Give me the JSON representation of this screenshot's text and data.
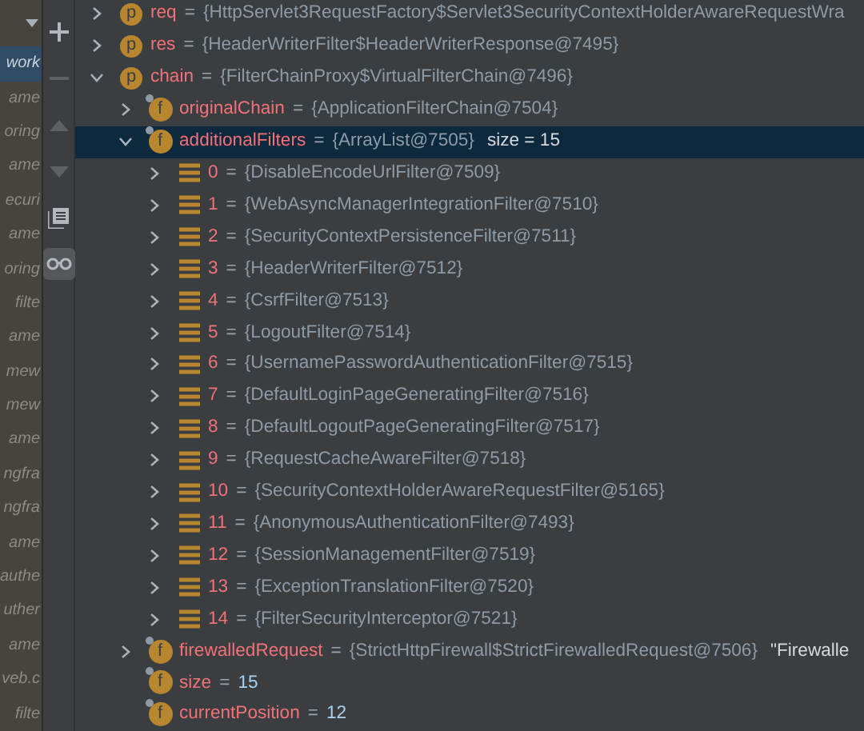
{
  "frames": [
    {
      "text": "work",
      "selected": true
    },
    {
      "text": "ame",
      "selected": false
    },
    {
      "text": "oring",
      "selected": false
    },
    {
      "text": "ame",
      "selected": false
    },
    {
      "text": "ecuri",
      "selected": false
    },
    {
      "text": "ame",
      "selected": false
    },
    {
      "text": "oring",
      "selected": false
    },
    {
      "text": "filte",
      "selected": false
    },
    {
      "text": "ame",
      "selected": false
    },
    {
      "text": "mew",
      "selected": false
    },
    {
      "text": "mew",
      "selected": false
    },
    {
      "text": "ame",
      "selected": false
    },
    {
      "text": "ngfra",
      "selected": false
    },
    {
      "text": "ngfra",
      "selected": false
    },
    {
      "text": "ame",
      "selected": false
    },
    {
      "text": "authe",
      "selected": false
    },
    {
      "text": "uther",
      "selected": false
    },
    {
      "text": "ame",
      "selected": false
    },
    {
      "text": "veb.c",
      "selected": false
    },
    {
      "text": "filte",
      "selected": false
    }
  ],
  "toolbar": [
    {
      "kind": "add",
      "disabled": false,
      "selected": false
    },
    {
      "kind": "remove",
      "disabled": true,
      "selected": false
    },
    {
      "kind": "up",
      "disabled": true,
      "selected": false
    },
    {
      "kind": "down",
      "disabled": true,
      "selected": false
    },
    {
      "kind": "copy",
      "disabled": false,
      "selected": false
    },
    {
      "kind": "watch",
      "disabled": false,
      "selected": true
    }
  ],
  "variables": [
    {
      "kind": "param",
      "icon": "p",
      "name": "req",
      "op": "=",
      "value": "{HttpServlet3RequestFactory$Servlet3SecurityContextHolderAwareRequestWra",
      "primitive": false,
      "expandable": true,
      "expanded": false,
      "selected": false
    },
    {
      "kind": "param",
      "icon": "p",
      "name": "res",
      "op": "=",
      "value": "{HeaderWriterFilter$HeaderWriterResponse@7495}",
      "primitive": false,
      "expandable": true,
      "expanded": false,
      "selected": false
    },
    {
      "kind": "param",
      "icon": "p",
      "name": "chain",
      "op": "=",
      "value": "{FilterChainProxy$VirtualFilterChain@7496}",
      "primitive": false,
      "expandable": true,
      "expanded": true,
      "selected": false,
      "children": [
        {
          "kind": "field",
          "icon": "f",
          "name": "originalChain",
          "op": "=",
          "value": "{ApplicationFilterChain@7504}",
          "primitive": false,
          "expandable": true,
          "expanded": false,
          "selected": false
        },
        {
          "kind": "field",
          "icon": "f",
          "name": "additionalFilters",
          "op": "=",
          "value": "{ArrayList@7505}",
          "primitive": false,
          "suffix": "size = 15",
          "expandable": true,
          "expanded": true,
          "selected": true,
          "children": [
            {
              "kind": "element",
              "name": "0",
              "op": "=",
              "value": "{DisableEncodeUrlFilter@7509}",
              "primitive": false,
              "expandable": true,
              "expanded": false,
              "selected": false
            },
            {
              "kind": "element",
              "name": "1",
              "op": "=",
              "value": "{WebAsyncManagerIntegrationFilter@7510}",
              "primitive": false,
              "expandable": true,
              "expanded": false,
              "selected": false
            },
            {
              "kind": "element",
              "name": "2",
              "op": "=",
              "value": "{SecurityContextPersistenceFilter@7511}",
              "primitive": false,
              "expandable": true,
              "expanded": false,
              "selected": false
            },
            {
              "kind": "element",
              "name": "3",
              "op": "=",
              "value": "{HeaderWriterFilter@7512}",
              "primitive": false,
              "expandable": true,
              "expanded": false,
              "selected": false
            },
            {
              "kind": "element",
              "name": "4",
              "op": "=",
              "value": "{CsrfFilter@7513}",
              "primitive": false,
              "expandable": true,
              "expanded": false,
              "selected": false
            },
            {
              "kind": "element",
              "name": "5",
              "op": "=",
              "value": "{LogoutFilter@7514}",
              "primitive": false,
              "expandable": true,
              "expanded": false,
              "selected": false
            },
            {
              "kind": "element",
              "name": "6",
              "op": "=",
              "value": "{UsernamePasswordAuthenticationFilter@7515}",
              "primitive": false,
              "expandable": true,
              "expanded": false,
              "selected": false
            },
            {
              "kind": "element",
              "name": "7",
              "op": "=",
              "value": "{DefaultLoginPageGeneratingFilter@7516}",
              "primitive": false,
              "expandable": true,
              "expanded": false,
              "selected": false
            },
            {
              "kind": "element",
              "name": "8",
              "op": "=",
              "value": "{DefaultLogoutPageGeneratingFilter@7517}",
              "primitive": false,
              "expandable": true,
              "expanded": false,
              "selected": false
            },
            {
              "kind": "element",
              "name": "9",
              "op": "=",
              "value": "{RequestCacheAwareFilter@7518}",
              "primitive": false,
              "expandable": true,
              "expanded": false,
              "selected": false
            },
            {
              "kind": "element",
              "name": "10",
              "op": "=",
              "value": "{SecurityContextHolderAwareRequestFilter@5165}",
              "primitive": false,
              "expandable": true,
              "expanded": false,
              "selected": false
            },
            {
              "kind": "element",
              "name": "11",
              "op": "=",
              "value": "{AnonymousAuthenticationFilter@7493}",
              "primitive": false,
              "expandable": true,
              "expanded": false,
              "selected": false
            },
            {
              "kind": "element",
              "name": "12",
              "op": "=",
              "value": "{SessionManagementFilter@7519}",
              "primitive": false,
              "expandable": true,
              "expanded": false,
              "selected": false
            },
            {
              "kind": "element",
              "name": "13",
              "op": "=",
              "value": "{ExceptionTranslationFilter@7520}",
              "primitive": false,
              "expandable": true,
              "expanded": false,
              "selected": false
            },
            {
              "kind": "element",
              "name": "14",
              "op": "=",
              "value": "{FilterSecurityInterceptor@7521}",
              "primitive": false,
              "expandable": true,
              "expanded": false,
              "selected": false
            }
          ]
        },
        {
          "kind": "field",
          "icon": "f",
          "name": "firewalledRequest",
          "op": "=",
          "value": "{StrictHttpFirewall$StrictFirewalledRequest@7506}",
          "primitive": false,
          "suffix": "\"Firewalle",
          "expandable": true,
          "expanded": false,
          "selected": false
        },
        {
          "kind": "field",
          "icon": "f",
          "name": "size",
          "op": "=",
          "value": "15",
          "primitive": true,
          "expandable": false,
          "selected": false
        },
        {
          "kind": "field",
          "icon": "f",
          "name": "currentPosition",
          "op": "=",
          "value": "12",
          "primitive": true,
          "expandable": false,
          "selected": false
        }
      ]
    }
  ]
}
